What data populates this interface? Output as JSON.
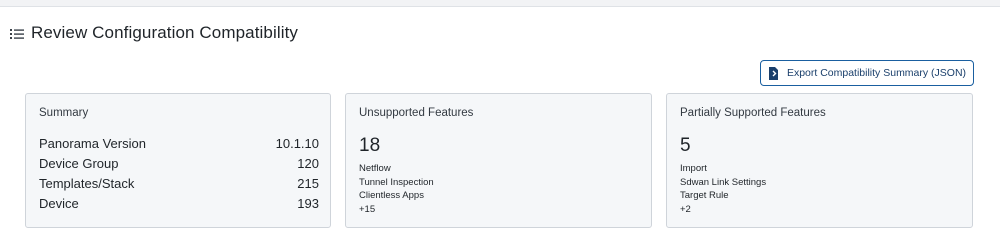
{
  "header": {
    "title": "Review Configuration Compatibility",
    "icon": "list-icon"
  },
  "export_button": {
    "label": "Export Compatibility Summary (JSON)",
    "icon": "export-file-icon",
    "color": "#1a5fa0"
  },
  "summary": {
    "title": "Summary",
    "rows": [
      {
        "label": "Panorama Version",
        "value": "10.1.10"
      },
      {
        "label": "Device Group",
        "value": "120"
      },
      {
        "label": "Templates/Stack",
        "value": "215"
      },
      {
        "label": "Device",
        "value": "193"
      }
    ]
  },
  "unsupported": {
    "title": "Unsupported Features",
    "count": "18",
    "items": [
      "Netflow",
      "Tunnel Inspection",
      "Clientless Apps",
      "+15"
    ]
  },
  "partial": {
    "title": "Partially Supported Features",
    "count": "5",
    "items": [
      "Import",
      "Sdwan Link Settings",
      "Target Rule",
      "+2"
    ]
  }
}
